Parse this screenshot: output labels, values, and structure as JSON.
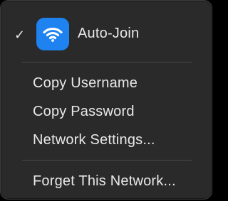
{
  "menu": {
    "auto_join": {
      "checked_mark": "✓",
      "label": "Auto-Join",
      "icon": "wifi-icon",
      "icon_color": "#1e82f0"
    },
    "items": [
      {
        "label": "Copy Username"
      },
      {
        "label": "Copy Password"
      },
      {
        "label": "Network Settings..."
      }
    ],
    "forget": {
      "label": "Forget This Network..."
    }
  },
  "colors": {
    "menu_background": "#2a2a2a",
    "text": "#e8e8e8",
    "separator": "#4a4a4a"
  }
}
